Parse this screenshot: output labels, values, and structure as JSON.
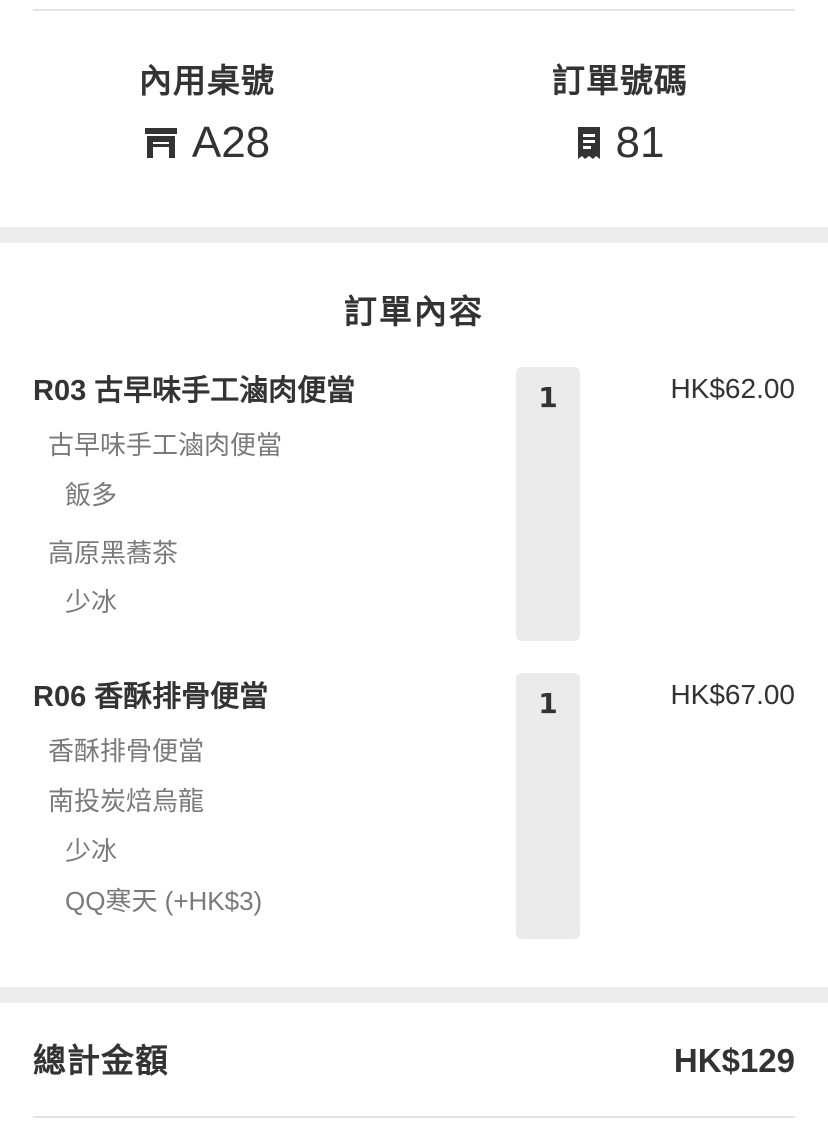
{
  "header": {
    "table": {
      "label": "內用桌號",
      "value": "A28",
      "icon": "table-icon"
    },
    "order": {
      "label": "訂單號碼",
      "value": "81",
      "icon": "receipt-icon"
    }
  },
  "order_contents": {
    "title": "訂單內容",
    "items": [
      {
        "name": "R03 古早味手工滷肉便當",
        "qty": "1",
        "price": "HK$62.00",
        "options": [
          {
            "text": "古早味手工滷肉便當",
            "level": 1
          },
          {
            "text": "飯多",
            "level": 2
          },
          {
            "text": "高原黑蕎茶",
            "level": 1
          },
          {
            "text": "少冰",
            "level": 2
          }
        ]
      },
      {
        "name": "R06 香酥排骨便當",
        "qty": "1",
        "price": "HK$67.00",
        "options": [
          {
            "text": "香酥排骨便當",
            "level": 1
          },
          {
            "text": "南投炭焙烏龍",
            "level": 1
          },
          {
            "text": "少冰",
            "level": 2
          },
          {
            "text": "QQ寒天 (+HK$3)",
            "level": 2
          }
        ]
      }
    ]
  },
  "total": {
    "label": "總計金額",
    "value": "HK$129"
  },
  "colors": {
    "text": "#333333",
    "muted": "#7a7a7a",
    "band": "#ececec",
    "qty_bg": "#ebebeb"
  }
}
